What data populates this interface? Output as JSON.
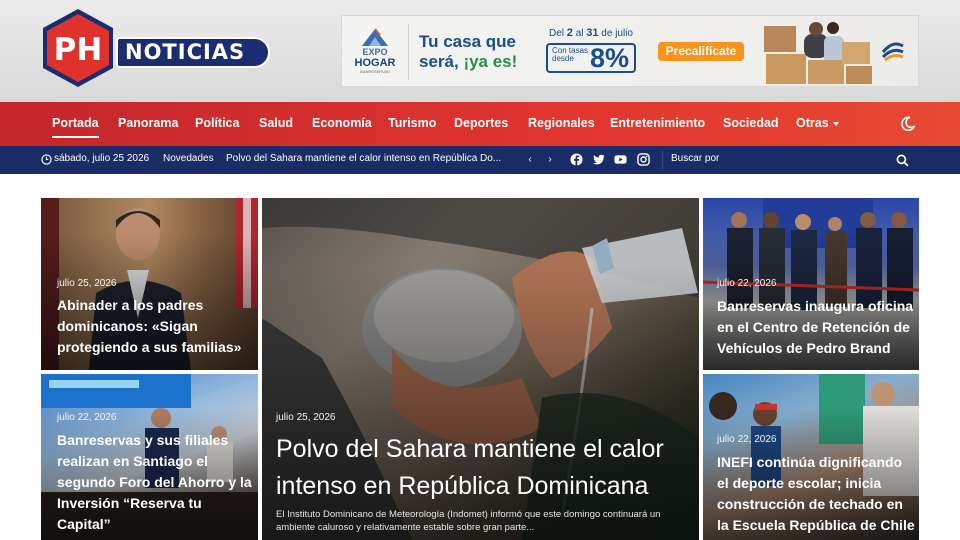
{
  "site": {
    "logo_text": "NOTICIAS",
    "logo_mark": "PH",
    "colors": {
      "brand_red": "#d8312d",
      "brand_navy": "#1a2c66"
    }
  },
  "banner": {
    "brand_line1": "EXPO",
    "brand_line2": "HOGAR",
    "brand_line3": "BANRESERVAS",
    "slogan_line1": "Tu casa que",
    "slogan_line2a": "será, ",
    "slogan_line2b": "¡ya es!",
    "date_range": "Del 2 al 31 de julio",
    "date_prefix": "Del ",
    "date_bold1": "2",
    "date_mid": " al ",
    "date_bold2": "31",
    "date_suffix": " de julio",
    "rate_label": "Con tasas desde",
    "rate_value": "8%",
    "cta": "Precalifícate",
    "brand_icon": "banreservas-icon"
  },
  "nav": {
    "items": [
      "Portada",
      "Panorama",
      "Política",
      "Salud",
      "Economía",
      "Turismo",
      "Deportes",
      "Regionales",
      "Entretenimiento",
      "Sociedad",
      "Otras"
    ],
    "active": "Portada",
    "dark_mode_icon": "moon-icon"
  },
  "topbar": {
    "date": "sábado, julio 25 2026",
    "ticker_label": "Novedades",
    "ticker_text": "Polvo del Sahara mantiene el calor intenso en República Do...",
    "search_label": "Buscar por",
    "social": [
      "facebook-icon",
      "twitter-icon",
      "youtube-icon",
      "instagram-icon"
    ]
  },
  "articles": {
    "a1": {
      "date": "julio 25, 2026",
      "title": "Abinader a los padres dominicanos: «Sigan protegiendo a sus familias»"
    },
    "a2": {
      "date": "julio 22, 2026",
      "title": "Banreservas y sus filiales realizan en Santiago el segundo Foro del Ahorro y la Inversión “Reserva tu Capital”"
    },
    "hero": {
      "date": "julio 25, 2026",
      "title": "Polvo del Sahara mantiene el calor intenso en República Dominicana",
      "excerpt": "El Instituto Dominicano de Meteorología (Indomet) informó que este domingo continuará un ambiente caluroso y relativamente estable sobre gran parte..."
    },
    "a3": {
      "date": "julio 22, 2026",
      "title": "Banreservas inaugura oficina en el Centro de Retención de Vehículos de Pedro Brand"
    },
    "a4": {
      "date": "julio 22, 2026",
      "title": "INEFI continúa dignificando el deporte escolar; inicia construcción de techado en la Escuela República de Chile"
    }
  }
}
